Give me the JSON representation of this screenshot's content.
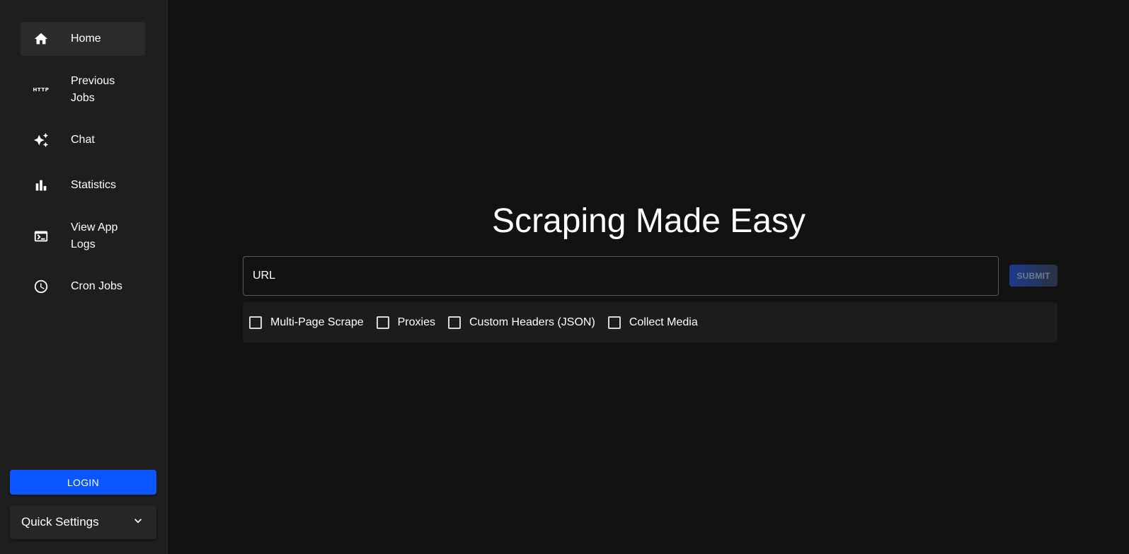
{
  "sidebar": {
    "items": [
      {
        "label": "Home",
        "icon": "home-icon",
        "active": true
      },
      {
        "label": "Previous Jobs",
        "icon": "http-icon",
        "icon_text": "HTTP"
      },
      {
        "label": "Chat",
        "icon": "sparkle-icon"
      },
      {
        "label": "Statistics",
        "icon": "bar-chart-icon"
      },
      {
        "label": "View App Logs",
        "icon": "terminal-icon"
      },
      {
        "label": "Cron Jobs",
        "icon": "clock-icon"
      }
    ],
    "login_label": "LOGIN",
    "quick_settings_label": "Quick Settings"
  },
  "main": {
    "title": "Scraping Made Easy",
    "url_placeholder": "URL",
    "submit_label": "SUBMIT",
    "options": [
      {
        "label": "Multi-Page Scrape",
        "checked": false
      },
      {
        "label": "Proxies",
        "checked": false
      },
      {
        "label": "Custom Headers (JSON)",
        "checked": false
      },
      {
        "label": "Collect Media",
        "checked": false
      }
    ]
  },
  "colors": {
    "background": "#121212",
    "sidebar": "#1e1e1e",
    "accent": "#0b57ff"
  }
}
